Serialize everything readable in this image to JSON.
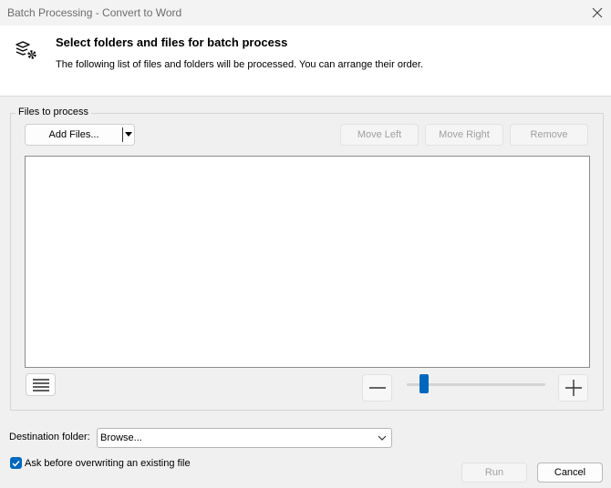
{
  "window": {
    "title": "Batch Processing - Convert to Word",
    "close_icon": "close-icon"
  },
  "header": {
    "icon": "batch-settings-icon",
    "title": "Select folders and files for batch process",
    "description": "The following list of files and folders will be processed. You can arrange their order."
  },
  "files_group": {
    "label": "Files to process",
    "add_files_label": "Add Files...",
    "move_left_label": "Move Left",
    "move_right_label": "Move Right",
    "remove_label": "Remove",
    "list_view_icon": "list-view-icon",
    "zoom_out_icon": "minus-icon",
    "zoom_in_icon": "plus-icon"
  },
  "destination": {
    "label": "Destination folder:",
    "value": "Browse..."
  },
  "options": {
    "ask_overwrite_label": "Ask before overwriting an existing file",
    "ask_overwrite_checked": true
  },
  "footer": {
    "run_label": "Run",
    "cancel_label": "Cancel"
  },
  "colors": {
    "accent": "#0067c0",
    "window_bg": "#f0f0f0",
    "header_bg": "#ffffff",
    "disabled_text": "#a0a0a0"
  }
}
